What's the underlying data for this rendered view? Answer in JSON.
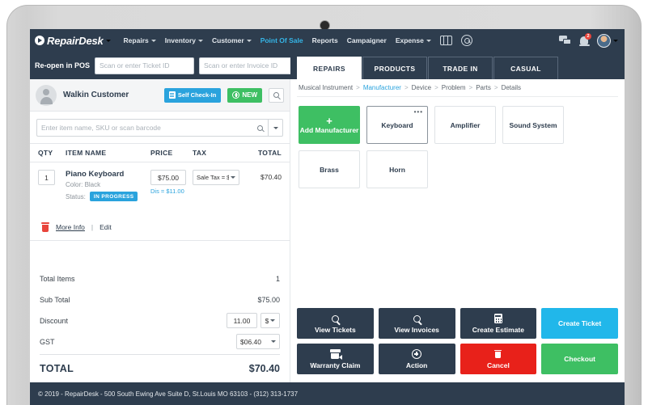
{
  "navbar": {
    "brand": "RepairDesk",
    "brand_caret": "▾",
    "menu": [
      {
        "label": "Repairs",
        "has_caret": true,
        "active": false
      },
      {
        "label": "Inventory",
        "has_caret": true,
        "active": false
      },
      {
        "label": "Customer",
        "has_caret": true,
        "active": false
      },
      {
        "label": "Point Of Sale",
        "has_caret": false,
        "active": true
      },
      {
        "label": "Reports",
        "has_caret": false,
        "active": false
      },
      {
        "label": "Campaigner",
        "has_caret": false,
        "active": false
      },
      {
        "label": "Expense",
        "has_caret": true,
        "active": false
      }
    ],
    "icons": {
      "grid": "grid-icon",
      "search": "search-icon",
      "chat": "chat-icon",
      "bell": "bell-icon",
      "avatar": "avatar-icon"
    },
    "notification_count": "2",
    "accent_active": "#35b6e8",
    "bar_color": "#2e3d4e"
  },
  "subbar": {
    "reopen_label": "Re-open in POS",
    "ticket_placeholder": "Scan or enter Ticket ID",
    "ticket_value": "",
    "invoice_placeholder": "Scan or enter Invoice ID",
    "invoice_value": "",
    "tabs": [
      {
        "label": "REPAIRS",
        "active": true
      },
      {
        "label": "PRODUCTS",
        "active": false
      },
      {
        "label": "TRADE IN",
        "active": false
      },
      {
        "label": "CASUAL",
        "active": false
      }
    ]
  },
  "customer": {
    "name": "Walkin Customer",
    "self_checkin_label": "Self Check-In",
    "new_label": "NEW",
    "search_icon": "search-icon"
  },
  "item_search": {
    "placeholder": "Enter item name, SKU or scan barcode",
    "value": ""
  },
  "cart": {
    "headers": {
      "qty": "QTY",
      "item_name": "ITEM NAME",
      "price": "PRICE",
      "tax": "TAX",
      "total": "TOTAL"
    },
    "row": {
      "qty": "1",
      "title": "Piano Keyboard",
      "color_line": "Color: Black",
      "status_label": "Status:",
      "status_badge": "IN PROGRESS",
      "price": "$75.00",
      "discount_note": "Dis = $11.00",
      "tax_select": "Sale Tax = $.",
      "total": "$70.40"
    },
    "actions": {
      "delete_icon": "trash-icon",
      "more_info": "More Info",
      "separator": "|",
      "edit": "Edit"
    }
  },
  "totals": {
    "total_items_label": "Total Items",
    "total_items_value": "1",
    "sub_total_label": "Sub Total",
    "sub_total_value": "$75.00",
    "discount_label": "Discount",
    "discount_value": "11.00",
    "discount_unit": "$",
    "gst_label": "GST",
    "gst_value": "$06.40",
    "grand_total_label": "TOTAL",
    "grand_total_value": "$70.40"
  },
  "breadcrumb": {
    "items": [
      "Musical Instrument",
      "Manufacturer",
      "Device",
      "Problem",
      "Parts",
      "Details"
    ],
    "active_index": 1,
    "separator": ">"
  },
  "tiles": [
    {
      "label": "Add Manufacturer",
      "type": "add",
      "plus": "+",
      "selected": false
    },
    {
      "label": "Keyboard",
      "type": "normal",
      "selected": true,
      "dots": "•••"
    },
    {
      "label": "Amplifier",
      "type": "normal",
      "selected": false
    },
    {
      "label": "Sound System",
      "type": "normal",
      "selected": false
    },
    {
      "label": "Brass",
      "type": "normal",
      "selected": false
    },
    {
      "label": "Horn",
      "type": "normal",
      "selected": false
    }
  ],
  "actions": [
    {
      "label": "View Tickets",
      "icon": "search-icon",
      "style": "dark"
    },
    {
      "label": "View Invoices",
      "icon": "search-icon",
      "style": "dark"
    },
    {
      "label": "Create Estimate",
      "icon": "calculator-icon",
      "style": "dark"
    },
    {
      "label": "Create Ticket",
      "icon": "none",
      "style": "cyan"
    },
    {
      "label": "Warranty Claim",
      "icon": "box-return-icon",
      "style": "dark"
    },
    {
      "label": "Action",
      "icon": "plus-circle-icon",
      "style": "dark"
    },
    {
      "label": "Cancel",
      "icon": "trash-icon",
      "style": "red"
    },
    {
      "label": "Checkout",
      "icon": "none",
      "style": "green"
    }
  ],
  "footer": {
    "text": "© 2019 - RepairDesk - 500 South Ewing Ave Suite D, St.Louis MO 63103  -  (312) 313-1737"
  },
  "colors": {
    "navy": "#2e3d4e",
    "cyan": "#21b7ea",
    "green": "#3ebf63",
    "red": "#e8211a",
    "link": "#2aa3dd"
  }
}
